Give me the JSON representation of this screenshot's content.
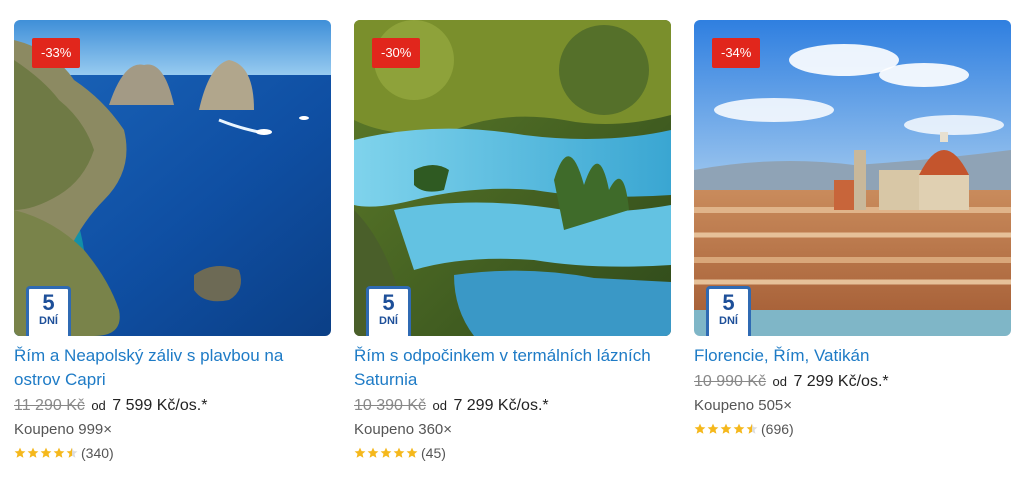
{
  "cards": [
    {
      "discount": "-33%",
      "days_number": "5",
      "days_label": "DNÍ",
      "title": "Řím a Neapolský záliv s plavbou na ostrov Capri",
      "old_price": "11 290 Kč",
      "from_label": "od",
      "price": "7 599 Kč/os.*",
      "bought": "Koupeno 999×",
      "rating_value": 4.5,
      "reviews": "(340)"
    },
    {
      "discount": "-30%",
      "days_number": "5",
      "days_label": "DNÍ",
      "title": "Řím s odpočinkem v termálních lázních Saturnia",
      "old_price": "10 390 Kč",
      "from_label": "od",
      "price": "7 299 Kč/os.*",
      "bought": "Koupeno 360×",
      "rating_value": 5,
      "reviews": "(45)"
    },
    {
      "discount": "-34%",
      "days_number": "5",
      "days_label": "DNÍ",
      "title": "Florencie, Řím, Vatikán",
      "old_price": "10 990 Kč",
      "from_label": "od",
      "price": "7 299 Kč/os.*",
      "bought": "Koupeno 505×",
      "rating_value": 4.5,
      "reviews": "(696)"
    }
  ],
  "colors": {
    "badge": "#e1261c",
    "title_link": "#1e7bc6",
    "days_border": "#2f6ab3",
    "star": "#f5b81c"
  }
}
